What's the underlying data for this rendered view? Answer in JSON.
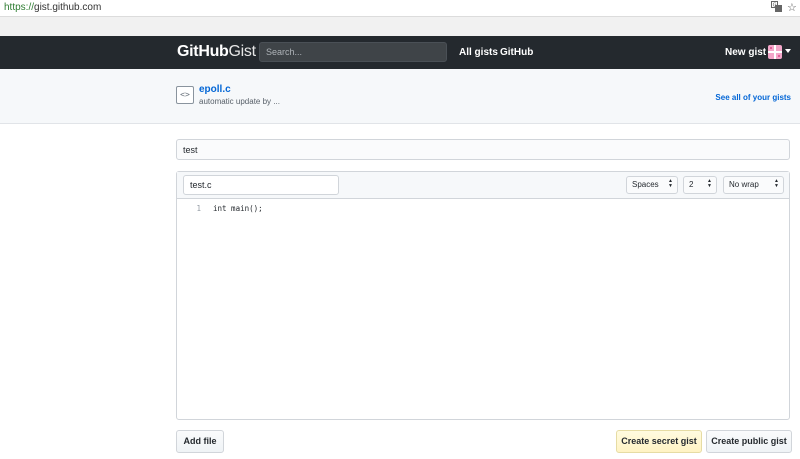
{
  "browser": {
    "url_scheme": "https://",
    "url_host": "gist.github.com",
    "translate_icon": "translate-icon",
    "bookmark_icon": "star-icon"
  },
  "header": {
    "logo_main": "GitHub",
    "logo_sub": "Gist",
    "search_placeholder": "Search...",
    "nav": [
      "All gists",
      "GitHub"
    ],
    "new_gist": "New gist",
    "background": "#24292e"
  },
  "subhead": {
    "icon": "file-code-icon",
    "gist_title": "epoll.c",
    "gist_description": "automatic update by ...",
    "see_all": "See all of your gists"
  },
  "form": {
    "description_value": "test",
    "filename_value": "test.c",
    "indent_mode": "Spaces",
    "indent_size": "2",
    "wrap_mode": "No wrap",
    "code_lines": [
      {
        "num": "1",
        "text": "int main();"
      }
    ]
  },
  "buttons": {
    "add_file": "Add file",
    "create_secret": "Create secret gist",
    "create_public": "Create public gist"
  }
}
